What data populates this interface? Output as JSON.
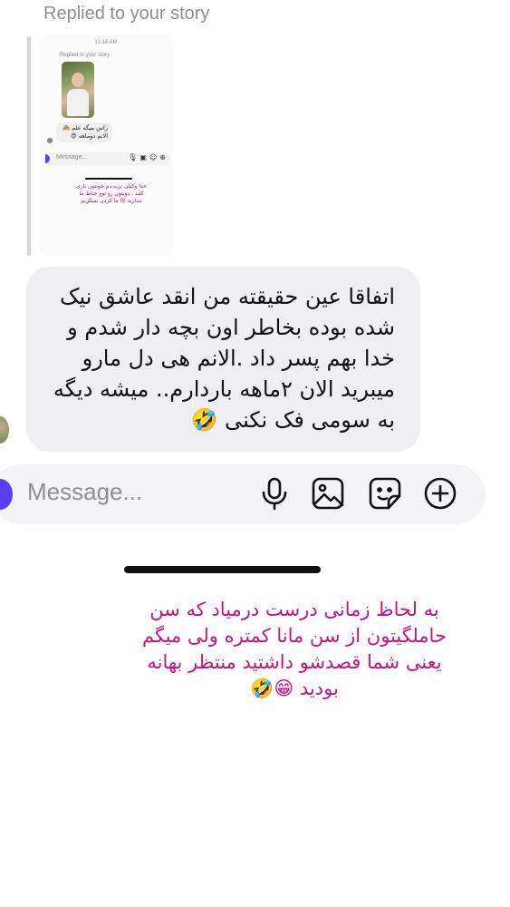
{
  "header": {
    "replied_label": "Replied to your story"
  },
  "story_thumbnail": {
    "time": "11:14 AM",
    "replied_label": "Replied to your story",
    "reply_text": "راس میگه علم 🙈 الانم دوماهه 😍",
    "message_placeholder": "Message...",
    "caption_text": "خدا وکیلی برید دم خونتون بازی کنید ، دوبتون رو نوو حیاط ما نندازید 😒 ما کردن نمیکریم"
  },
  "message": {
    "text": "اتفاقا عین حقیقته من انقد عاشق نیک شده بوده بخاطر اون بچه دار شدم و خدا بهم پسر داد .الانم هی دل مارو میبرید الان ۲ماهه باردارم.. میشه دیگه به سومی فک نکنی 🤣"
  },
  "composer": {
    "placeholder": "Message...",
    "icons": [
      "microphone-icon",
      "image-icon",
      "sticker-icon",
      "plus-icon"
    ]
  },
  "caption": {
    "text": "به لحاظ زمانی درست درمیاد که سن حاملگیتون از سن مانا کمتره ولی میگم یعنی شما قصدشو داشتید منتظر بهانه بودید 😁🤣"
  },
  "colors": {
    "accent": "#5b3df5",
    "caption": "#c8127f",
    "bubble": "#efeff2"
  }
}
